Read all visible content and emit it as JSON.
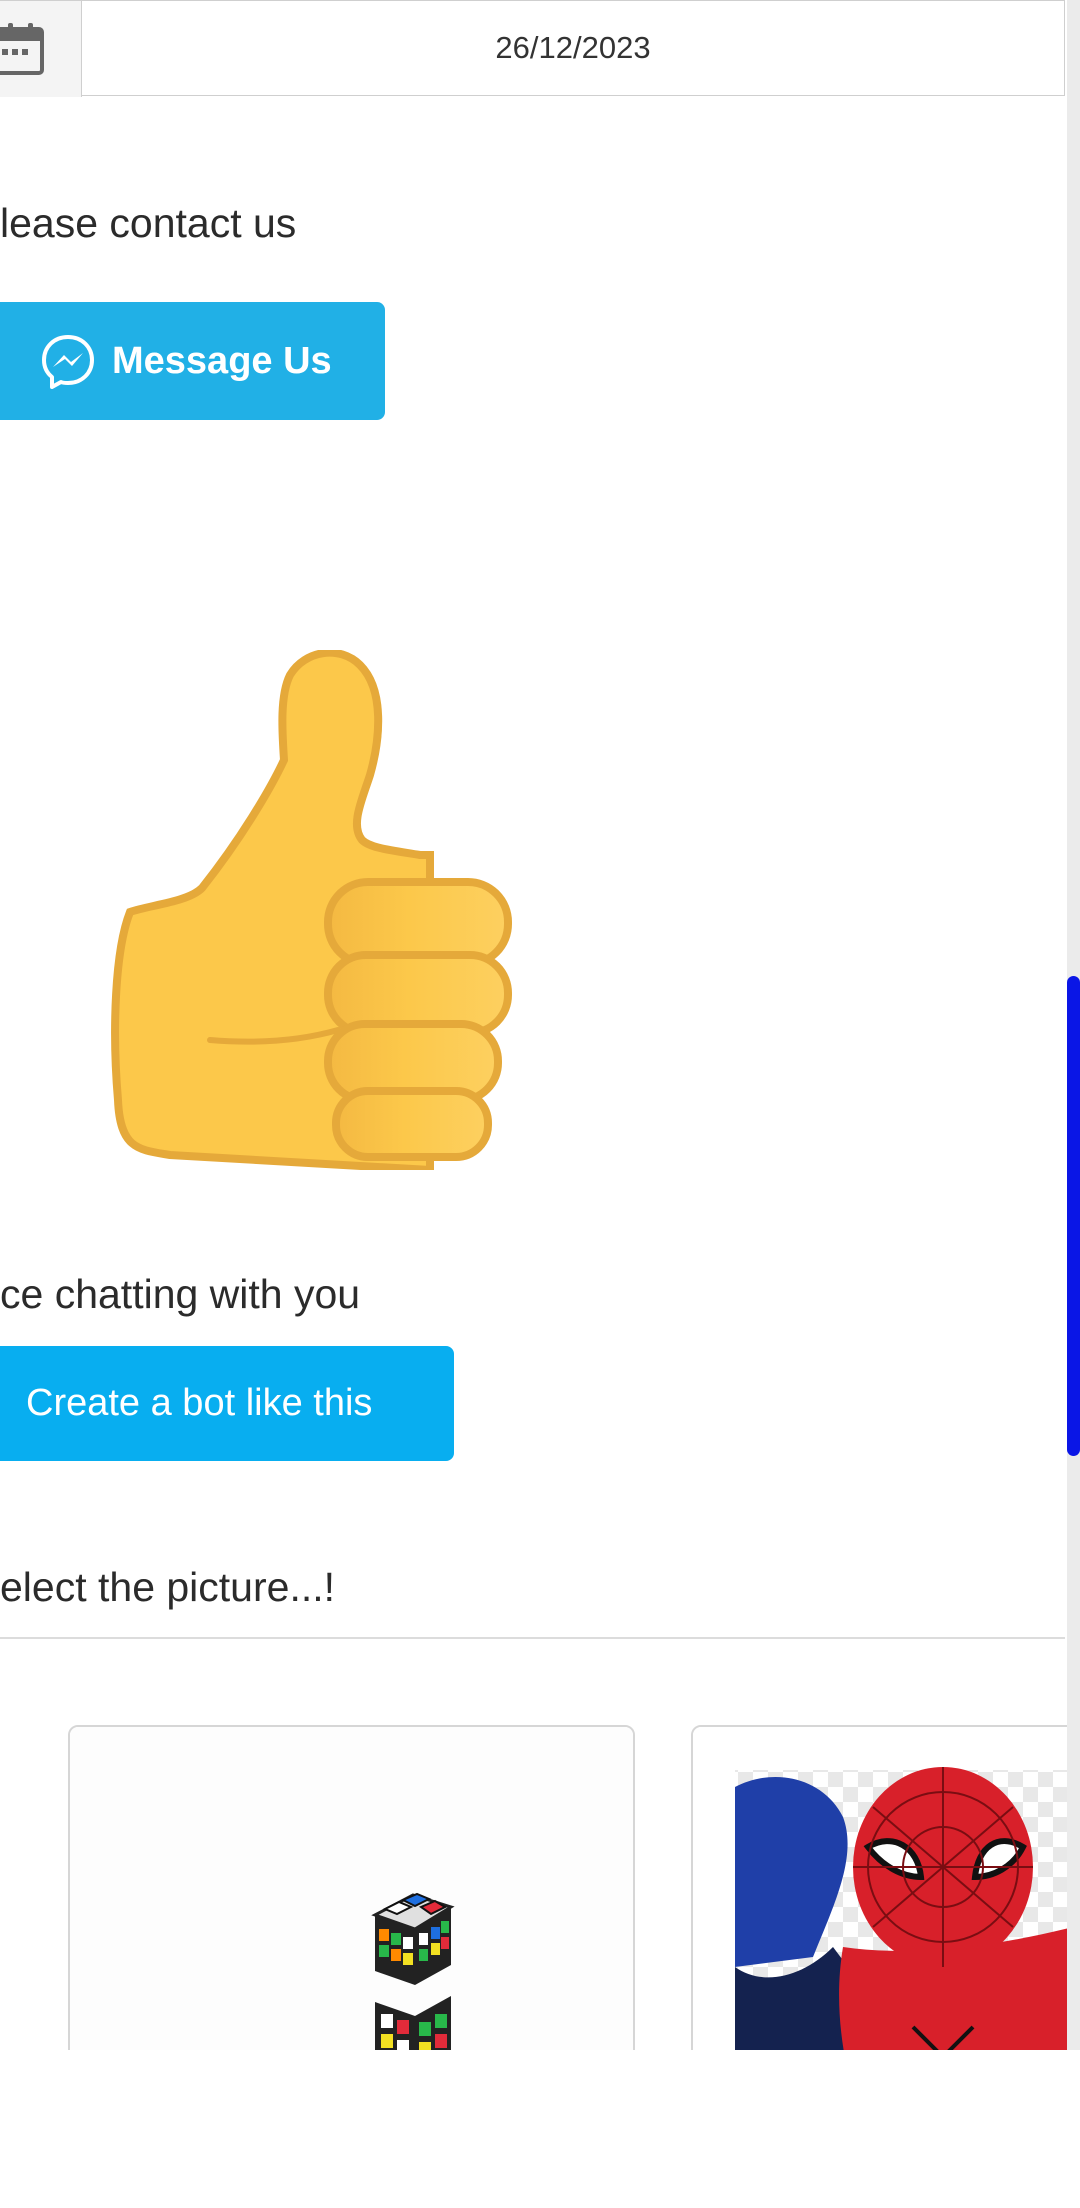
{
  "date_field": {
    "value": "26/12/2023",
    "icon": "calendar-icon"
  },
  "messages": {
    "contact_text": "lease contact us",
    "message_button_label": "Message Us",
    "message_icon": "messenger-icon",
    "thumb_image": "thumbs-up-emoji",
    "chat_text": "ce chatting with you",
    "create_bot_button_label": "Create a bot like this",
    "select_picture_text": "elect the picture...!"
  },
  "picture_cards": [
    {
      "image": "rubiks-cube-image"
    },
    {
      "image": "spiderman-image"
    }
  ],
  "colors": {
    "message_button": "#21b0e6",
    "create_bot_button": "#08aef0",
    "thumb": "#fcc84a",
    "scrollbar_thumb": "#0a16e6"
  }
}
